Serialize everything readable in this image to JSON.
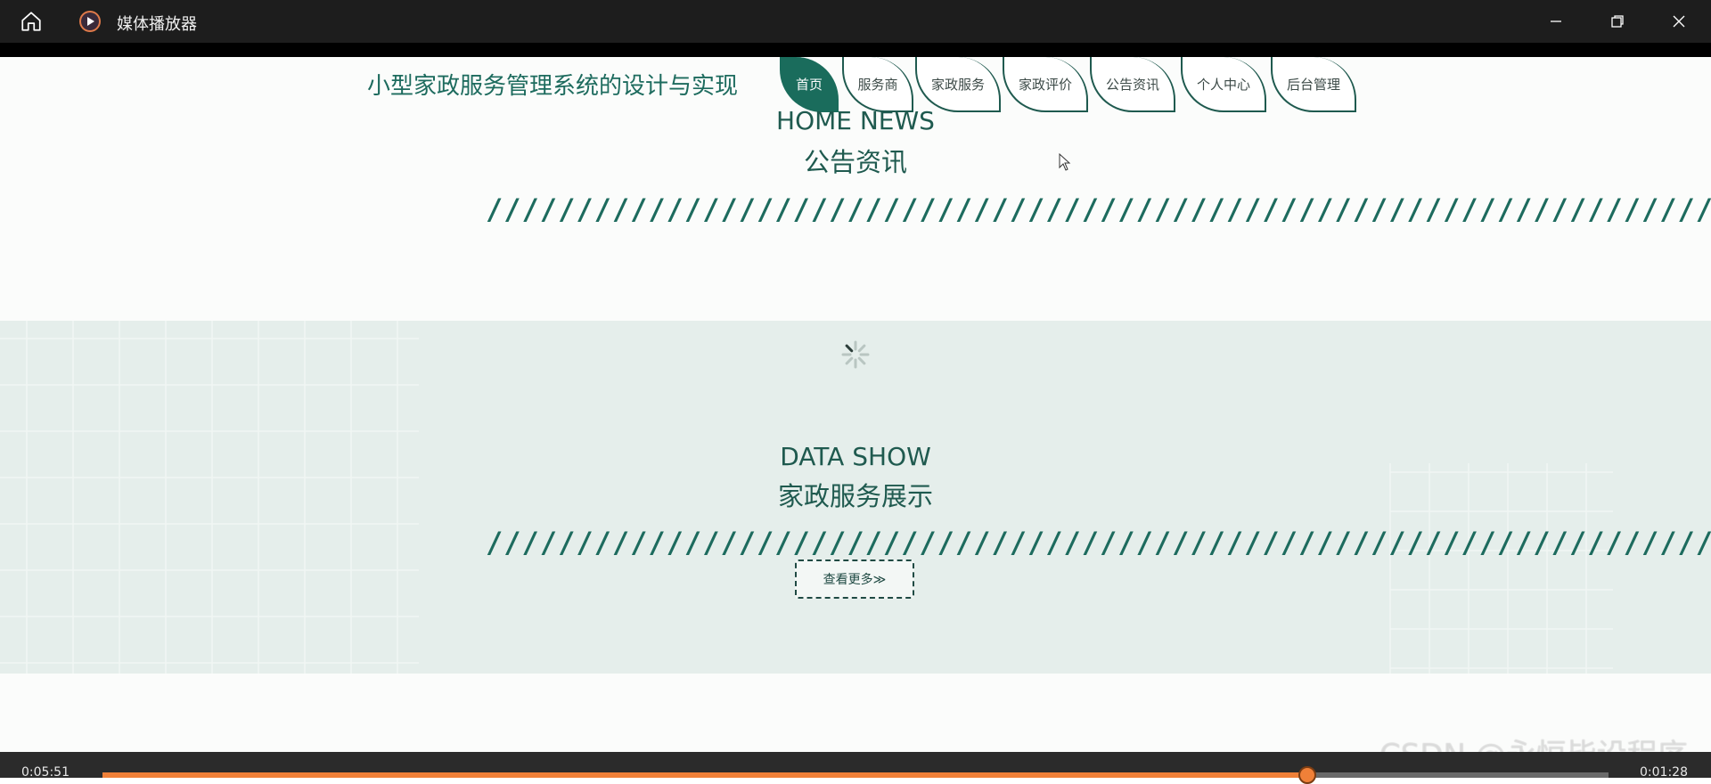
{
  "window": {
    "title": "媒体播放器",
    "icons": [
      "home-icon",
      "media-player-icon",
      "minimize-icon",
      "restore-icon",
      "close-icon"
    ]
  },
  "site": {
    "title": "小型家政服务管理系统的设计与实现",
    "nav": [
      {
        "label": "首页",
        "active": true
      },
      {
        "label": "服务商",
        "active": false
      },
      {
        "label": "家政服务",
        "active": false
      },
      {
        "label": "家政评价",
        "active": false
      },
      {
        "label": "公告资讯",
        "active": false
      },
      {
        "label": "个人中心",
        "active": false
      },
      {
        "label": "后台管理",
        "active": false
      }
    ]
  },
  "news": {
    "title_en": "HOME NEWS",
    "title_cn": "公告资讯",
    "divider": "//////////////////////////////////////////////////////////////////////"
  },
  "data_show": {
    "title_en": "DATA SHOW",
    "title_cn": "家政服务展示",
    "divider": "//////////////////////////////////////////////////////////////////////",
    "more_label": "查看更多≫"
  },
  "player": {
    "elapsed": "0:05:51",
    "remaining": "0:01:28",
    "progress": 0.8
  },
  "watermark": "CSDN @永恒毕设程序",
  "colors": {
    "accent": "#1a6c5c",
    "progress": "#f08038",
    "titlebar": "#1d1d1d"
  }
}
